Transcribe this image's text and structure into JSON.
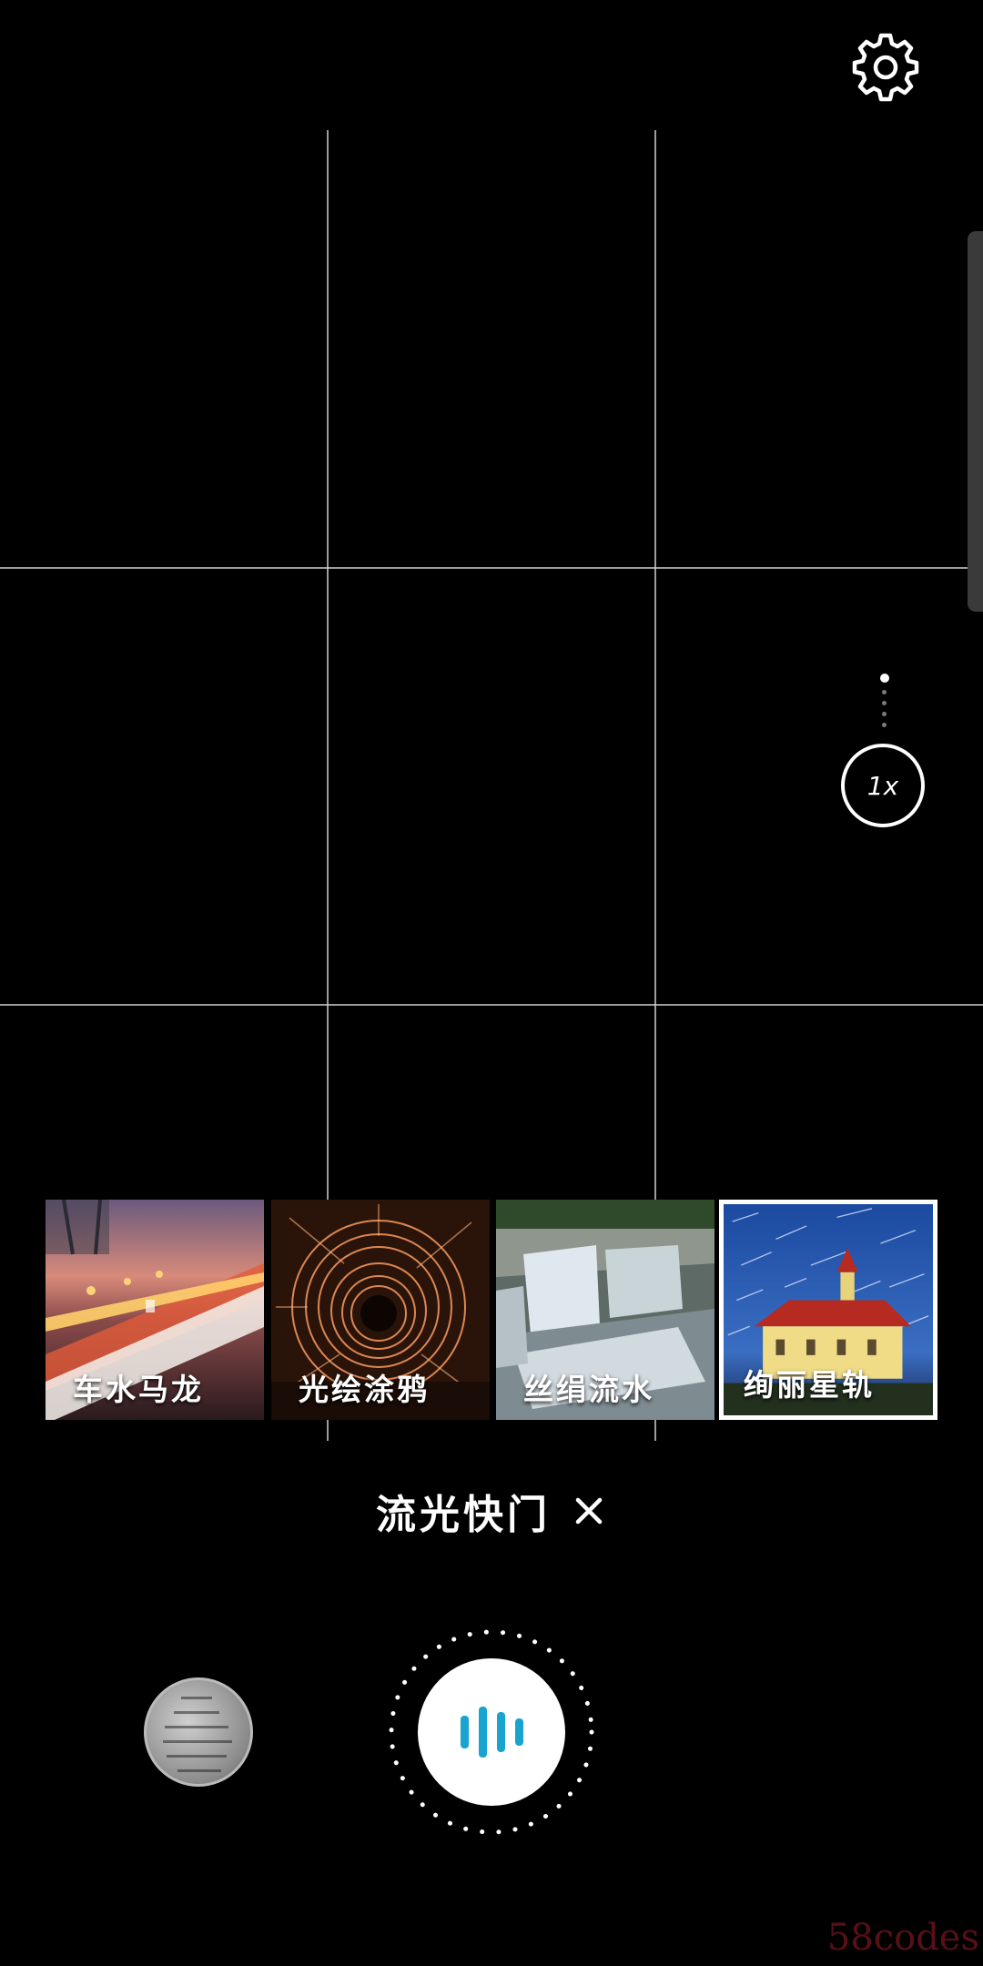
{
  "mode": {
    "title": "流光快门"
  },
  "zoom": {
    "label": "1x"
  },
  "presets": [
    {
      "label": "车水马龙",
      "selected": false
    },
    {
      "label": "光绘涂鸦",
      "selected": false
    },
    {
      "label": "丝绢流水",
      "selected": false
    },
    {
      "label": "绚丽星轨",
      "selected": true
    }
  ],
  "watermark": "58codes",
  "icons": {
    "settings": "gear-icon",
    "close": "close-icon",
    "shutter": "sound-bars-icon"
  },
  "colors": {
    "background": "#000000",
    "shutter_accent": "#19a3cf",
    "grid": "#d2d2d2"
  }
}
